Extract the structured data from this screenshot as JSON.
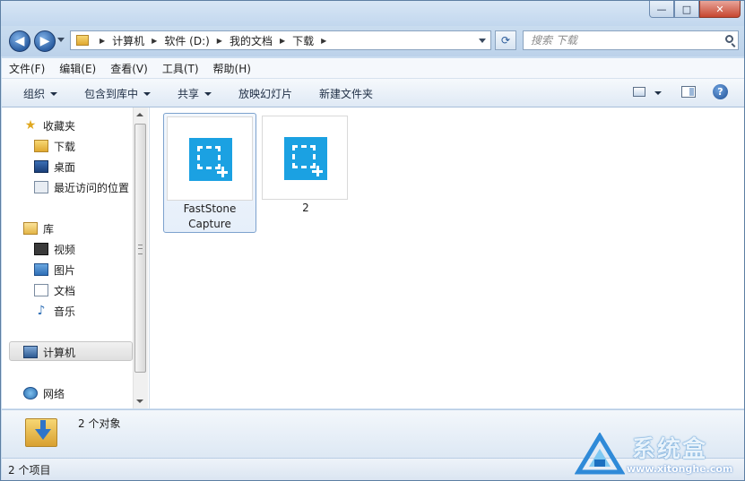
{
  "window": {
    "controls": {
      "minimize": "—",
      "maximize": "□",
      "close": "✕"
    }
  },
  "nav": {
    "back_icon": "arrow-left-icon",
    "forward_icon": "arrow-right-icon",
    "breadcrumb": [
      "计算机",
      "软件 (D:)",
      "我的文档",
      "下载"
    ],
    "search_placeholder": "搜索 下载"
  },
  "menubar": {
    "items": [
      "文件(F)",
      "编辑(E)",
      "查看(V)",
      "工具(T)",
      "帮助(H)"
    ]
  },
  "toolbar": {
    "organize": "组织",
    "include_in_library": "包含到库中",
    "share": "共享",
    "slideshow": "放映幻灯片",
    "new_folder": "新建文件夹"
  },
  "sidebar": {
    "favorites": {
      "label": "收藏夹",
      "items": [
        "下载",
        "桌面",
        "最近访问的位置"
      ]
    },
    "libraries": {
      "label": "库",
      "items": [
        "视频",
        "图片",
        "文档",
        "音乐"
      ]
    },
    "computer": {
      "label": "计算机"
    },
    "network": {
      "label": "网络"
    }
  },
  "files": [
    {
      "name_line1": "FastStone",
      "name_line2": "Capture",
      "selected": true
    },
    {
      "name_line1": "2",
      "name_line2": "",
      "selected": false
    }
  ],
  "details": {
    "text": "2 个对象"
  },
  "status": {
    "text": "2 个项目"
  },
  "watermark": {
    "title": "系统盒",
    "url": "www.xitonghe.com"
  },
  "colors": {
    "accent": "#1ba1e2",
    "titlebar": "#c9dcef"
  }
}
